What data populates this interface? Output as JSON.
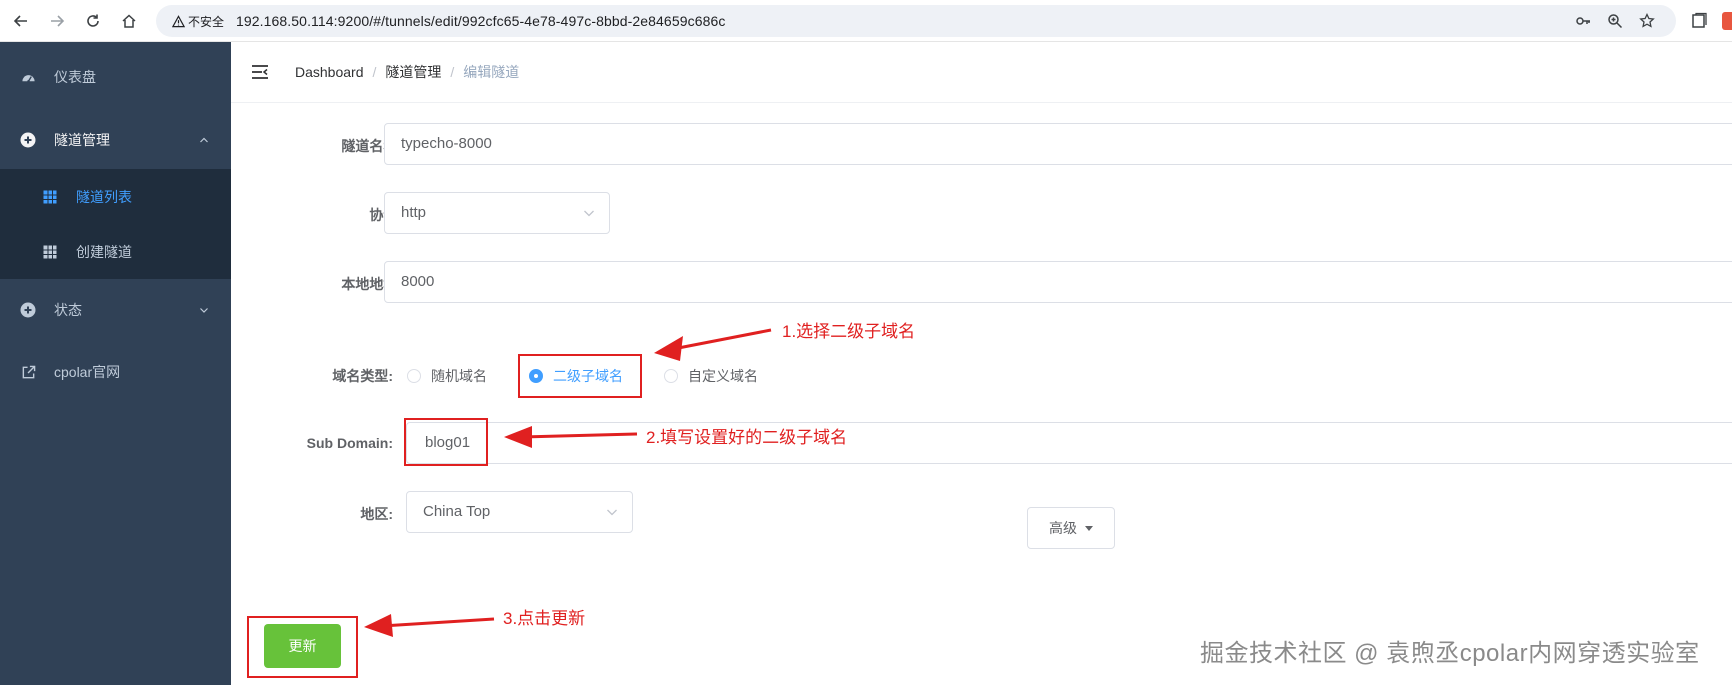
{
  "browser": {
    "security_label": "不安全",
    "url": "192.168.50.114:9200/#/tunnels/edit/992cfc65-4e78-497c-8bbd-2e84659c686c"
  },
  "sidebar": {
    "items": [
      {
        "label": "仪表盘"
      },
      {
        "label": "隧道管理"
      },
      {
        "label": "状态"
      },
      {
        "label": "cpolar官网"
      }
    ],
    "submenu": [
      {
        "label": "隧道列表"
      },
      {
        "label": "创建隧道"
      }
    ],
    "colors": {
      "background": "#304156",
      "submenu_background": "#1f2d3d",
      "active": "#409eff"
    }
  },
  "breadcrumb": {
    "items": [
      "Dashboard",
      "隧道管理",
      "编辑隧道"
    ]
  },
  "form": {
    "name_label": "隧道名称:",
    "name_value": "typecho-8000",
    "protocol_label": "协议:",
    "protocol_value": "http",
    "local_label": "本地地址:",
    "local_value": "8000",
    "domain_type_label": "域名类型:",
    "domain_types": [
      {
        "label": "随机域名",
        "checked": false
      },
      {
        "label": "二级子域名",
        "checked": true
      },
      {
        "label": "自定义域名",
        "checked": false
      }
    ],
    "subdomain_label": "Sub Domain:",
    "subdomain_value": "blog01",
    "region_label": "地区:",
    "region_value": "China Top",
    "advanced_label": "高级",
    "update_label": "更新"
  },
  "annotations": {
    "step1": "1.选择二级子域名",
    "step2": "2.填写设置好的二级子域名",
    "step3": "3.点击更新",
    "color": "#e02020"
  },
  "watermark": "掘金技术社区 @ 袁煦丞cpolar内网穿透实验室"
}
